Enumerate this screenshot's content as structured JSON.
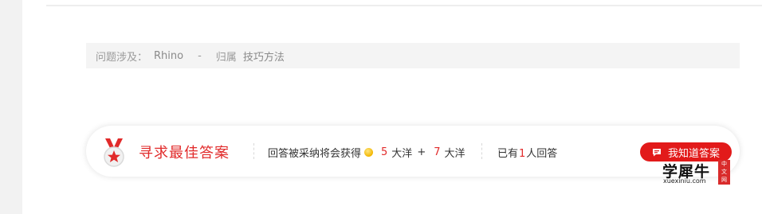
{
  "topic": {
    "label": "问题涉及：",
    "product": "Rhino",
    "separator": "-",
    "category_label": "归属",
    "category": "技巧方法"
  },
  "answer_bar": {
    "title": "寻求最佳答案",
    "reward_prefix": "回答被采纳将会获得",
    "reward_amount": "5",
    "reward_unit": "大洋",
    "plus": "+",
    "bonus_amount": "7",
    "bonus_unit": "大洋",
    "answered_prefix": "已有",
    "answered_count": "1",
    "answered_suffix": "人回答",
    "button_label": "我知道答案"
  },
  "logo": {
    "text": "学犀牛",
    "url": "xuexiniu.com",
    "tag": "中文网"
  },
  "colors": {
    "accent": "#e12a2a",
    "button": "#e21a1a",
    "topic_bg": "#f4f4f4"
  },
  "icons": [
    "medal-icon",
    "coin-icon",
    "chat-icon"
  ]
}
